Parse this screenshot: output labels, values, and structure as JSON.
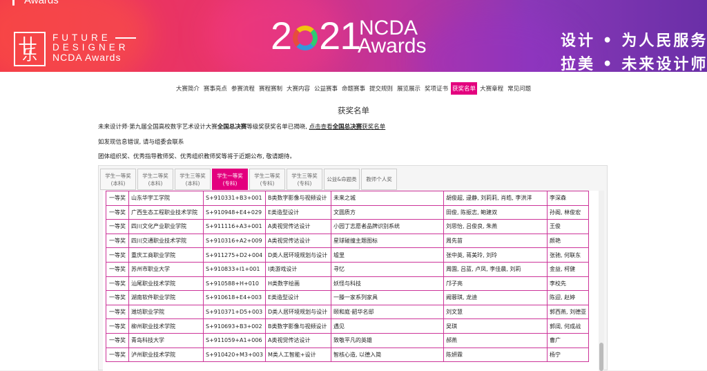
{
  "banner": {
    "top_text": "Awards",
    "logo_chars": [
      "卄",
      "乐"
    ],
    "fd_line1": "FUTURE",
    "fd_line2": "DESIGNER",
    "fd_line3": "NCDA Awards",
    "year_prefix": "2",
    "year_suffix": "21",
    "ncda": "NCDA",
    "awards": "Awards",
    "slogan_line1": "设计 • 为人民服务",
    "slogan_line2": "拉美 • 未来设计师"
  },
  "nav": {
    "items": [
      "大赛简介",
      "赛事亮点",
      "参赛流程",
      "赛程赛制",
      "大赛内容",
      "公益赛事",
      "命题赛事",
      "提交规则",
      "展览展示",
      "奖项证书",
      "获奖名单",
      "大赛章程",
      "常见问题"
    ],
    "active_index": 10
  },
  "page": {
    "title": "获奖名单",
    "notice1_a": "未来设计师·第九届全国高校数字艺术设计大赛",
    "notice1_b": "全国总决赛",
    "notice1_c": "等级奖获奖名单已揭晓, ",
    "notice1_link_a": "点击查看",
    "notice1_link_b": "全国总决赛",
    "notice1_link_c": "获奖名单",
    "notice2": "如发现信息错误, 请与组委会联系",
    "notice3": "团体组织奖、优秀指导教师奖、优秀组织教师奖等将于近期公布, 敬请期待。"
  },
  "tabs": [
    {
      "l1": "学生一等奖",
      "l2": "(本科)"
    },
    {
      "l1": "学生二等奖",
      "l2": "(本科)"
    },
    {
      "l1": "学生三等奖",
      "l2": "(本科)"
    },
    {
      "l1": "学生一等奖",
      "l2": "(专科)"
    },
    {
      "l1": "学生二等奖",
      "l2": "(专科)"
    },
    {
      "l1": "学生三等奖",
      "l2": "(专科)"
    },
    {
      "l1": "公益&命题类",
      "l2": ""
    },
    {
      "l1": "教师个人奖",
      "l2": ""
    }
  ],
  "active_tab": 3,
  "table": {
    "rows": [
      [
        "一等奖",
        "山东华宇工学院",
        "S+910331+B3+001",
        "B类数字影像与视频设计",
        "未来之城",
        "胡俊超, 逯静, 刘莉莉, 肖皓, 李洪洋",
        "李深森"
      ],
      [
        "一等奖",
        "广西生态工程职业技术学院",
        "S+910948+E4+029",
        "E类造型设计",
        "文圆质方",
        "田俊, 陈振志, 鲍建双",
        "孙阁, 林俊宏"
      ],
      [
        "一等奖",
        "四川文化产业职业学院",
        "S+911116+A3+001",
        "A类视觉传达设计",
        "小园丁志愿者品牌识别系统",
        "刘思怡, 吕俊良, 朱燕",
        "王俊"
      ],
      [
        "一等奖",
        "四川交通职业技术学院",
        "S+910316+A2+009",
        "A类视觉传达设计",
        "星球碰撞主题图标",
        "周先苗",
        "颜艳"
      ],
      [
        "一等奖",
        "重庆工商职业学院",
        "S+911275+D2+004",
        "D类人居环境规划与设计",
        "墟里",
        "张中英, 蒋美玲, 刘玲",
        "张驰, 何联东"
      ],
      [
        "一等奖",
        "苏州市职业大学",
        "S+910833+I1+001",
        "I类游戏设计",
        "寻忆",
        "周園, 吕蓝, 卢凤, 李佳晨, 刘莉",
        "金益, 柯健"
      ],
      [
        "一等奖",
        "汕尾职业技术学院",
        "S+910588+H+010",
        "H类数字绘画",
        "妖怪与科技",
        "邝子亮",
        "李校先"
      ],
      [
        "一等奖",
        "湖南软件职业学院",
        "S+910618+E4+003",
        "E类造型设计",
        "一滕一家系列家具",
        "阙蓉琪, 龙迪",
        "陈迎, 赵婷"
      ],
      [
        "一等奖",
        "潍坊职业学院",
        "S+910371+D5+003",
        "D类人居环境规划与设计",
        "颐和庭·韶华名邸",
        "刘文慧",
        "郭西燕, 刘德亚"
      ],
      [
        "一等奖",
        "柳州职业技术学院",
        "S+910693+B3+002",
        "B类数字影像与视频设计",
        "遇见",
        "吴琪",
        "郭阔, 何成战"
      ],
      [
        "一等奖",
        "青岛科技大学",
        "S+911059+A1+006",
        "A类视觉传达设计",
        "致敬平凡的英雄",
        "郝燕",
        "曹广"
      ],
      [
        "一等奖",
        "泸州职业技术学院",
        "S+910420+M3+003",
        "M类人工智能+设计",
        "智核心造, 以德入简",
        "陈妍霖",
        "杨宁"
      ]
    ]
  },
  "colors": {
    "accent": "#e3007e",
    "table_border": "#cc3399"
  }
}
